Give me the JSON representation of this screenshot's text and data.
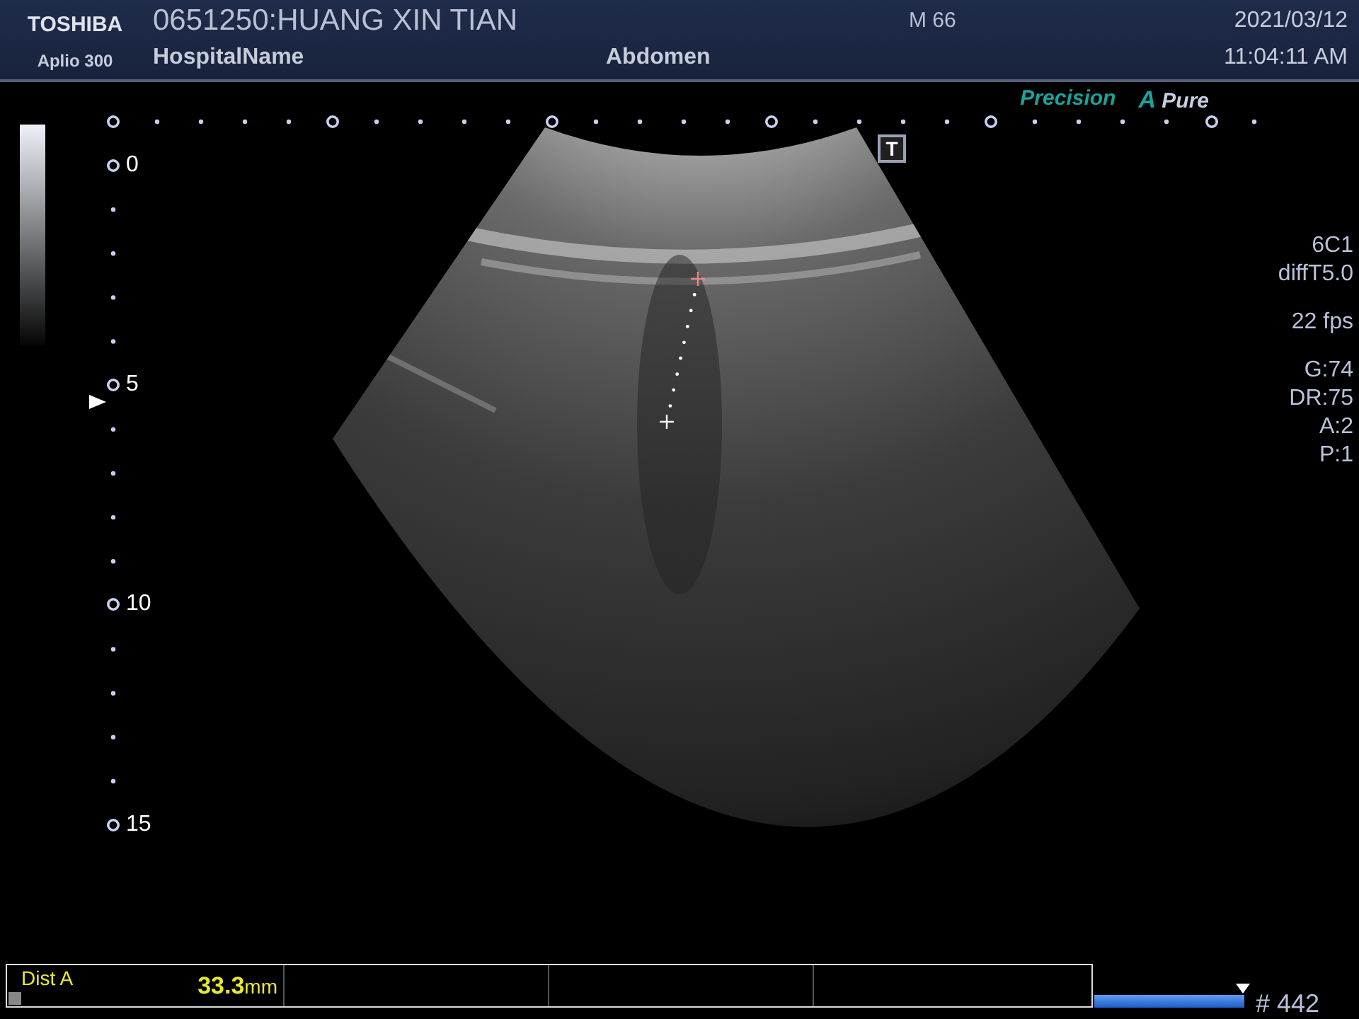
{
  "header": {
    "brand": "TOSHIBA",
    "model": "Aplio 300",
    "patient": "0651250:HUANG XIN TIAN",
    "hospital": "HospitalName",
    "exam": "Abdomen",
    "patient_info": "M 66",
    "date": "2021/03/12",
    "time": "11:04:11 AM"
  },
  "logos": {
    "precision": "Precision",
    "apure_letter": "A",
    "apure_word": "Pure"
  },
  "t_badge": "T",
  "depth_labels": [
    "0",
    "5",
    "10",
    "15"
  ],
  "params": [
    [
      "6C1",
      "diffT5.0"
    ],
    [
      "22 fps"
    ],
    [
      "G:74",
      "DR:75",
      "A:2",
      "P:1"
    ]
  ],
  "measurements": [
    {
      "label": "Dist A",
      "value": "33.3",
      "unit": "mm"
    }
  ],
  "cine": {
    "level": 1,
    "frame": "# 442"
  }
}
